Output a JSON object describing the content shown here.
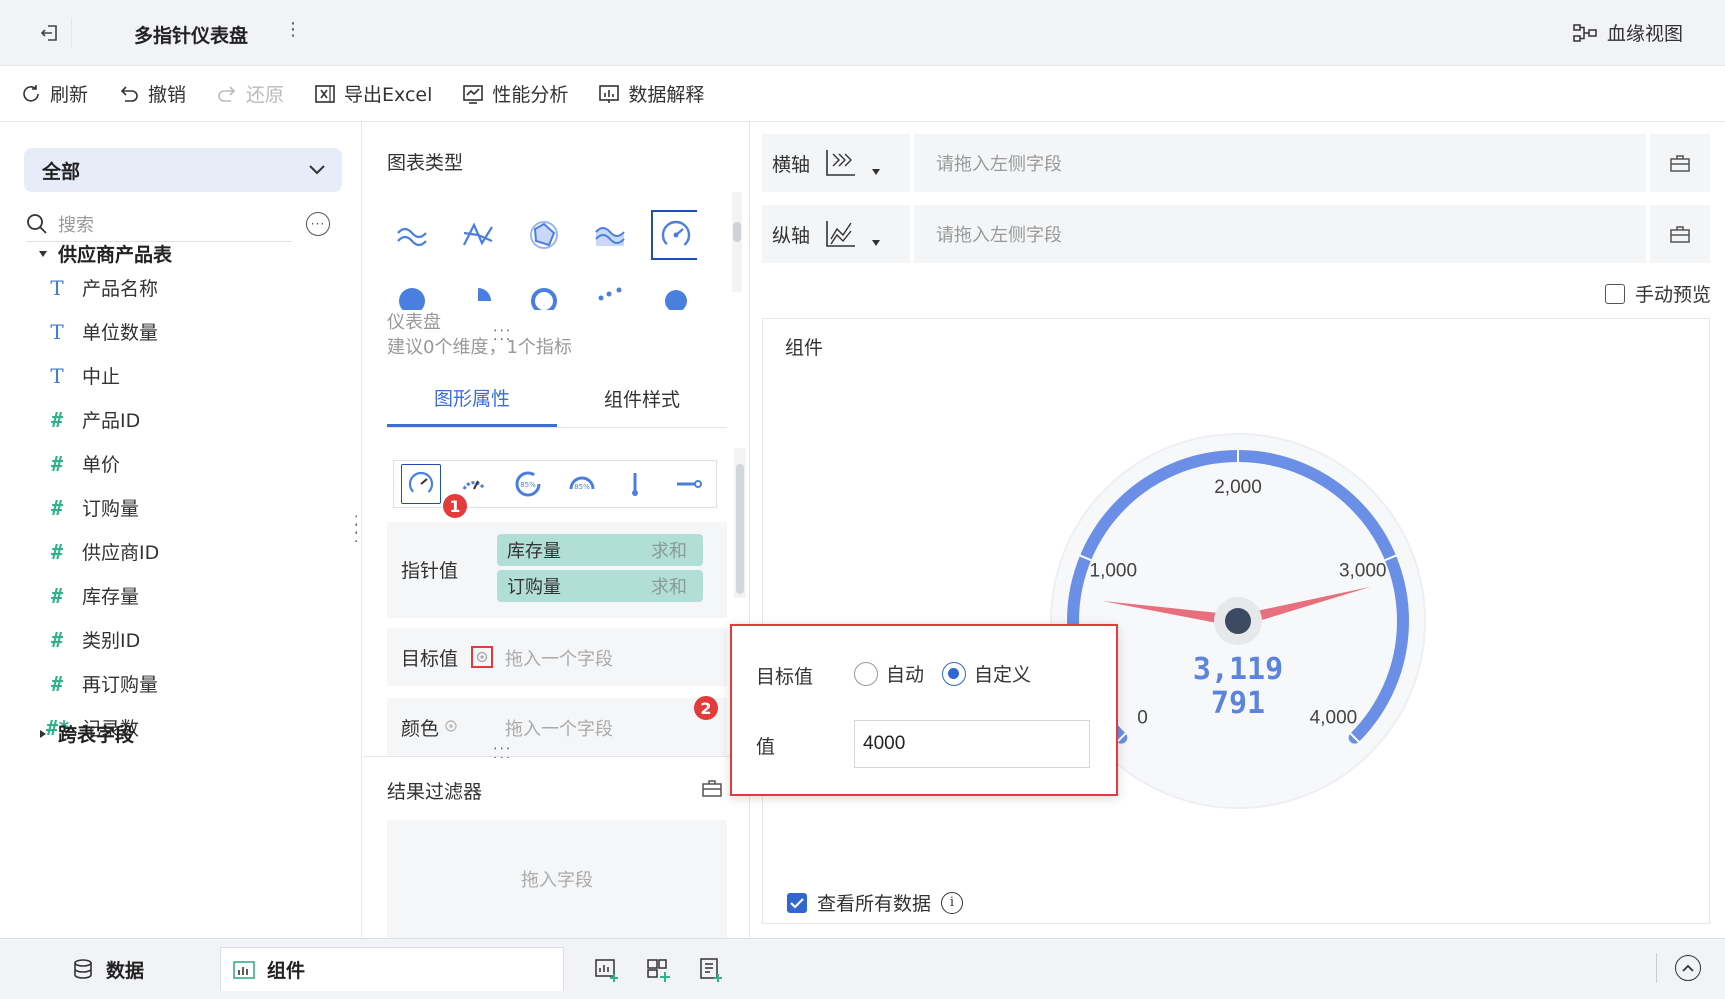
{
  "window": {
    "title": "多指针仪表盘",
    "lineage_label": "血缘视图"
  },
  "toolbar": {
    "refresh": "刷新",
    "undo": "撤销",
    "redo": "还原",
    "export": "导出Excel",
    "performance": "性能分析",
    "explain": "数据解释"
  },
  "data_panel": {
    "scope": "全部",
    "search_placeholder": "搜索",
    "table_group": "供应商产品表",
    "cross_group": "跨表字段",
    "fields": [
      {
        "type": "T",
        "name": "产品名称"
      },
      {
        "type": "T",
        "name": "单位数量"
      },
      {
        "type": "T",
        "name": "中止"
      },
      {
        "type": "#",
        "name": "产品ID"
      },
      {
        "type": "#",
        "name": "单价"
      },
      {
        "type": "#",
        "name": "订购量"
      },
      {
        "type": "#",
        "name": "供应商ID"
      },
      {
        "type": "#",
        "name": "库存量"
      },
      {
        "type": "#",
        "name": "类别ID"
      },
      {
        "type": "#",
        "name": "再订购量"
      },
      {
        "type": "#*",
        "name": "记录数"
      }
    ]
  },
  "config_panel": {
    "chart_type_title": "图表类型",
    "selected_chart_name": "仪表盘",
    "selected_chart_hint": "建议0个维度，1个指标",
    "tabs": [
      "图形属性",
      "组件样式"
    ],
    "pointer_label": "指针值",
    "pointer_fields": [
      {
        "name": "库存量",
        "agg": "求和"
      },
      {
        "name": "订购量",
        "agg": "求和"
      }
    ],
    "target_label": "目标值",
    "target_placeholder": "拖入一个字段",
    "color_label": "颜色",
    "color_placeholder": "拖入一个字段",
    "filter_title": "结果过滤器",
    "filter_placeholder": "拖入字段",
    "badge1": "1",
    "badge2": "2"
  },
  "axes": {
    "x_label": "横轴",
    "y_label": "纵轴",
    "x_placeholder": "请拖入左侧字段",
    "y_placeholder": "请拖入左侧字段"
  },
  "preview": {
    "manual_preview": "手动预览",
    "widget_title": "组件",
    "view_all": "查看所有数据"
  },
  "popover": {
    "target_label": "目标值",
    "options": [
      "自动",
      "自定义"
    ],
    "selected": "自定义",
    "value_label": "值",
    "value": "4000"
  },
  "gauge": {
    "min": 0,
    "max": 4000,
    "ticks": [
      "0",
      "1,000",
      "2,000",
      "3,000",
      "4,000"
    ],
    "value1": "3,119",
    "value2": "791",
    "pointer_values": [
      3119,
      791
    ],
    "arc_color": "#6b8fe6",
    "pointer_color": "#e8707e",
    "value_color": "#5b84dc"
  },
  "bottom": {
    "data_tab": "数据",
    "widget_tab": "组件"
  },
  "colors": {
    "accent": "#3a6fd8",
    "highlight": "#e33a3a",
    "pill": "#b1ded6"
  }
}
